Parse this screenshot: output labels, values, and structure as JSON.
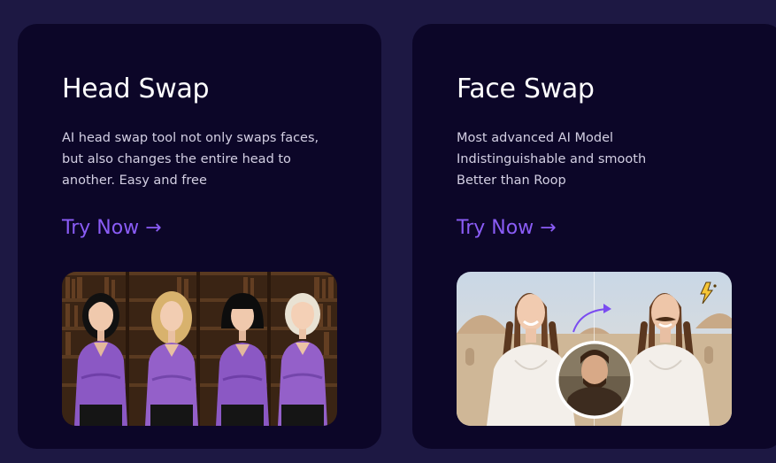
{
  "cards": [
    {
      "title": "Head Swap",
      "description_lines": [
        "AI head swap tool not only swaps faces,",
        "but also changes the entire head to",
        "another. Easy and free"
      ],
      "cta_label": "Try Now →",
      "image_icon": "head-swap-preview-image"
    },
    {
      "title": "Face Swap",
      "description_lines": [
        "Most advanced AI Model",
        "Indistinguishable and smooth",
        "Better than Roop"
      ],
      "cta_label": "Try Now →",
      "image_icon": "face-swap-preview-image",
      "badge_icon": "lightning-icon"
    }
  ],
  "colors": {
    "page_bg": "#1d1843",
    "card_bg": "#0c0628",
    "accent": "#8a5cf6",
    "title": "#ffffff",
    "description": "#d3cfe3"
  }
}
